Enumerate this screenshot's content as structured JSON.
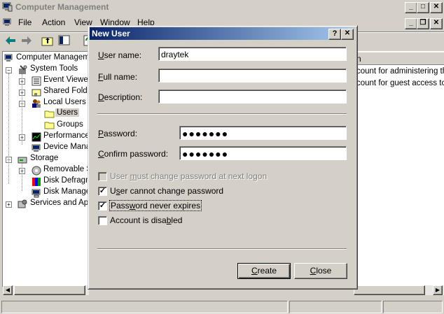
{
  "main_window": {
    "title": "Computer Management",
    "menu": {
      "file": "File",
      "action": "Action",
      "view": "View",
      "window": "Window",
      "help": "Help"
    }
  },
  "tree": {
    "root": "Computer Manageme",
    "system_tools": "System Tools",
    "event_viewer": "Event Viewer",
    "shared_folders": "Shared Folde",
    "local_users": "Local Users a",
    "users": "Users",
    "groups": "Groups",
    "performance": "Performance",
    "device_manager": "Device Manag",
    "storage": "Storage",
    "removable": "Removable S",
    "disk_defrag": "Disk Defragm",
    "disk_management": "Disk Manager",
    "services": "Services and App"
  },
  "list": {
    "header_fragment": "n",
    "row1": "count for administering th",
    "row2": "count for guest access to"
  },
  "dialog": {
    "title": "New User",
    "help_glyph": "?",
    "close_glyph": "✕",
    "username_label": "User name:",
    "username_value": "draytek",
    "fullname_label": "Full name:",
    "fullname_value": "",
    "description_label": "Description:",
    "description_value": "",
    "password_label": "Password:",
    "password_value": "●●●●●●●",
    "confirm_label": "Confirm password:",
    "confirm_value": "●●●●●●●",
    "must_change_label": "User must change password at next logon",
    "must_change_checked": false,
    "cannot_change_label": "User cannot change password",
    "cannot_change_checked": true,
    "never_expires_label": "Password never expires",
    "never_expires_checked": true,
    "disabled_label": "Account is disabled",
    "disabled_checked": false,
    "create_button": "Create",
    "close_button": "Close"
  }
}
